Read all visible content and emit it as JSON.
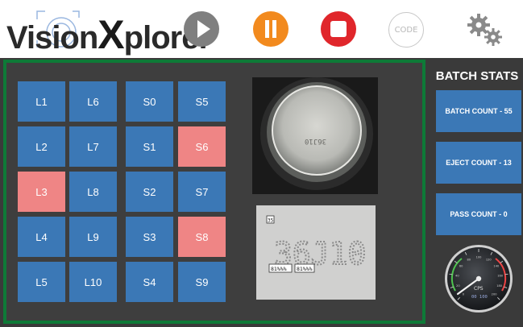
{
  "app": {
    "logo_text_a": "Vision",
    "logo_text_b": "X",
    "logo_text_c": "plorer"
  },
  "toolbar": {
    "play_icon": "play-icon",
    "pause_icon": "pause-icon",
    "stop_icon": "stop-icon",
    "code_label": "CODE",
    "settings_icon": "gears-icon",
    "colors": {
      "play": "#7f7f7f",
      "pause": "#f28a1e",
      "stop": "#e0262b"
    }
  },
  "lanes": [
    {
      "label": "L1",
      "status": "ok"
    },
    {
      "label": "L2",
      "status": "ok"
    },
    {
      "label": "L3",
      "status": "reject"
    },
    {
      "label": "L4",
      "status": "ok"
    },
    {
      "label": "L5",
      "status": "ok"
    },
    {
      "label": "L6",
      "status": "ok"
    },
    {
      "label": "L7",
      "status": "ok"
    },
    {
      "label": "L8",
      "status": "ok"
    },
    {
      "label": "L9",
      "status": "ok"
    },
    {
      "label": "L10",
      "status": "ok"
    }
  ],
  "stations": [
    {
      "label": "S0",
      "status": "ok"
    },
    {
      "label": "S1",
      "status": "ok"
    },
    {
      "label": "S2",
      "status": "ok"
    },
    {
      "label": "S3",
      "status": "ok"
    },
    {
      "label": "S4",
      "status": "ok"
    },
    {
      "label": "S5",
      "status": "ok"
    },
    {
      "label": "S6",
      "status": "reject"
    },
    {
      "label": "S7",
      "status": "ok"
    },
    {
      "label": "S8",
      "status": "reject"
    },
    {
      "label": "S9",
      "status": "ok"
    }
  ],
  "inspection": {
    "code_text": "36J10",
    "roi_tag": "35",
    "score_left": "81%%%",
    "score_right": "81%%%"
  },
  "batch_stats": {
    "title": "BATCH STATS",
    "batch_count": "BATCH COUNT - 55",
    "eject_count": "EJECT COUNT - 13",
    "pass_count": "PASS COUNT - 0"
  },
  "gauge": {
    "unit": "CPS",
    "readout": "00 100",
    "ticks": [
      "0",
      "20",
      "40",
      "60",
      "80",
      "100",
      "120",
      "140",
      "160",
      "180",
      "200"
    ],
    "value": 0
  },
  "colors": {
    "tile_ok": "#3b78b6",
    "tile_reject": "#ef8585",
    "panel_border": "#0e7a37"
  }
}
